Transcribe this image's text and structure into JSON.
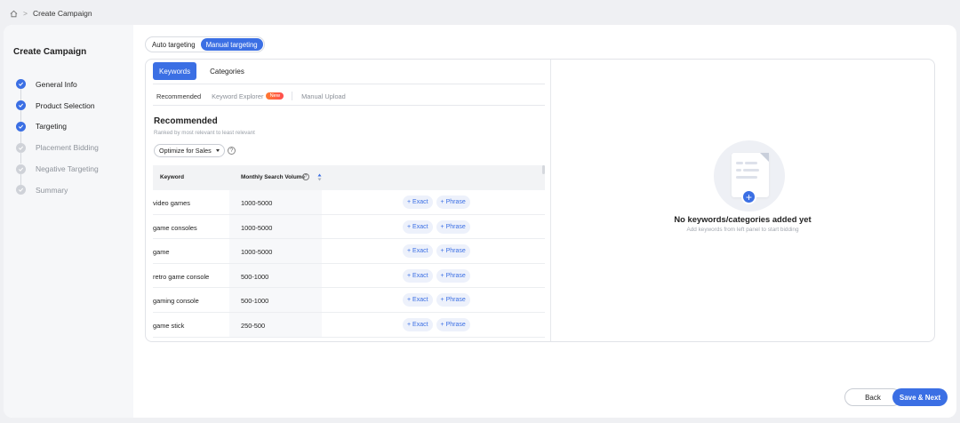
{
  "breadcrumb": {
    "current": "Create Campaign",
    "separator": ">"
  },
  "sidebar": {
    "title": "Create Campaign",
    "steps": [
      {
        "label": "General Info",
        "status": "done"
      },
      {
        "label": "Product Selection",
        "status": "done"
      },
      {
        "label": "Targeting",
        "status": "done"
      },
      {
        "label": "Placement Bidding",
        "status": "todo"
      },
      {
        "label": "Negative Targeting",
        "status": "todo"
      },
      {
        "label": "Summary",
        "status": "todo"
      }
    ]
  },
  "targeting_toggle": {
    "options": [
      "Auto targeting",
      "Manual targeting"
    ],
    "selected": "Manual targeting"
  },
  "tabs": {
    "primary": [
      "Keywords",
      "Categories"
    ],
    "primary_selected": "Keywords"
  },
  "subtabs": {
    "recommended": "Recommended",
    "explorer": "Keyword Explorer",
    "explorer_badge": "New",
    "upload": "Manual Upload",
    "selected": "Recommended"
  },
  "recommended": {
    "title": "Recommended",
    "subtitle": "Ranked by most relevant to least relevant",
    "optimize_label": "Optimize for Sales",
    "help": "?"
  },
  "table": {
    "headers": {
      "keyword": "Keyword",
      "volume": "Monthly Search Volume",
      "volume_help": "?"
    },
    "rows": [
      {
        "keyword": "video games",
        "volume": "1000-5000",
        "exact": "+ Exact",
        "phrase": "+ Phrase"
      },
      {
        "keyword": "game consoles",
        "volume": "1000-5000",
        "exact": "+ Exact",
        "phrase": "+ Phrase"
      },
      {
        "keyword": "game",
        "volume": "1000-5000",
        "exact": "+ Exact",
        "phrase": "+ Phrase"
      },
      {
        "keyword": "retro game console",
        "volume": "500-1000",
        "exact": "+ Exact",
        "phrase": "+ Phrase"
      },
      {
        "keyword": "gaming console",
        "volume": "500-1000",
        "exact": "+ Exact",
        "phrase": "+ Phrase"
      },
      {
        "keyword": "game stick",
        "volume": "250-500",
        "exact": "+ Exact",
        "phrase": "+ Phrase"
      }
    ]
  },
  "empty_state": {
    "title": "No keywords/categories added yet",
    "subtitle": "Add keywords from left panel to start bidding",
    "plus": "+"
  },
  "footer": {
    "back": "Back",
    "next": "Save & Next"
  },
  "colors": {
    "accent": "#3b6fe4",
    "badge": "#ff5a3c"
  }
}
